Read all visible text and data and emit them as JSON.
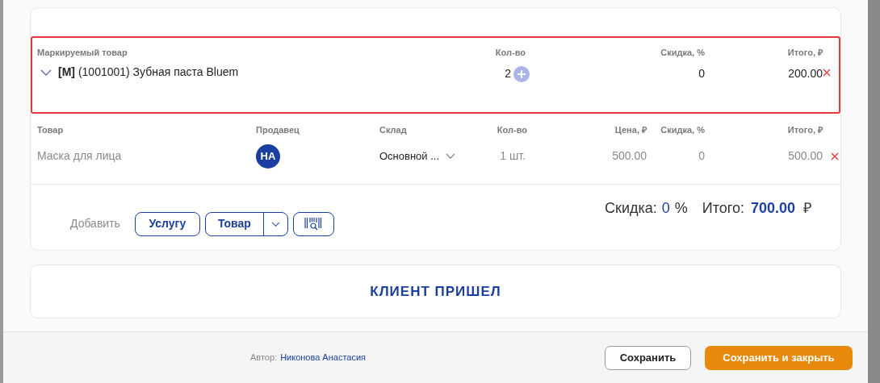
{
  "marked_table": {
    "columns": [
      "Маркируемый товар",
      "Кол-во",
      "Скидка, %",
      "Итого, ₽"
    ],
    "rows": [
      {
        "code": "[M]",
        "name": "(1001001) Зубная паста Bluem",
        "qty": "2",
        "discount": "0",
        "total": "200.00"
      }
    ]
  },
  "goods_table": {
    "columns": [
      "Товар",
      "Продавец",
      "Склад",
      "Кол-во",
      "Цена, ₽",
      "Скидка, %",
      "Итого, ₽"
    ],
    "rows": [
      {
        "name": "Маска для лица",
        "seller": "НА",
        "warehouse": "Основной ...",
        "qty": "1 шт.",
        "price": "500.00",
        "discount": "0",
        "total": "500.00"
      }
    ]
  },
  "add": {
    "label": "Добавить",
    "buttons": [
      "Услугу",
      "Товар"
    ]
  },
  "summary": {
    "discount_label": "Скидка:",
    "discount_value": "0",
    "discount_unit": "%",
    "total_label": "Итого:",
    "total_value": "700.00",
    "currency": "₽"
  },
  "client_button": "КЛИЕНТ ПРИШЕЛ",
  "footer": {
    "author_label": "Автор:",
    "author": "Никонова Анастасия",
    "save": "Сохранить",
    "save_close": "Сохранить и закрыть"
  }
}
